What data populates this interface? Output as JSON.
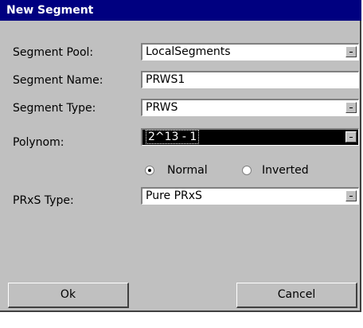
{
  "window": {
    "title": "New Segment"
  },
  "form": {
    "pool_label": "Segment Pool:",
    "pool_value": "LocalSegments",
    "name_label": "Segment Name:",
    "name_value": "PRWS1",
    "type_label": "Segment Type:",
    "type_value": "PRWS",
    "polynom_label": "Polynom:",
    "polynom_value": "2^13 - 1",
    "radio_normal": "Normal",
    "radio_inverted": "Inverted",
    "radio_selected": "Normal",
    "prxs_label": "PRxS Type:",
    "prxs_value": "Pure PRxS"
  },
  "buttons": {
    "ok": "Ok",
    "cancel": "Cancel"
  }
}
